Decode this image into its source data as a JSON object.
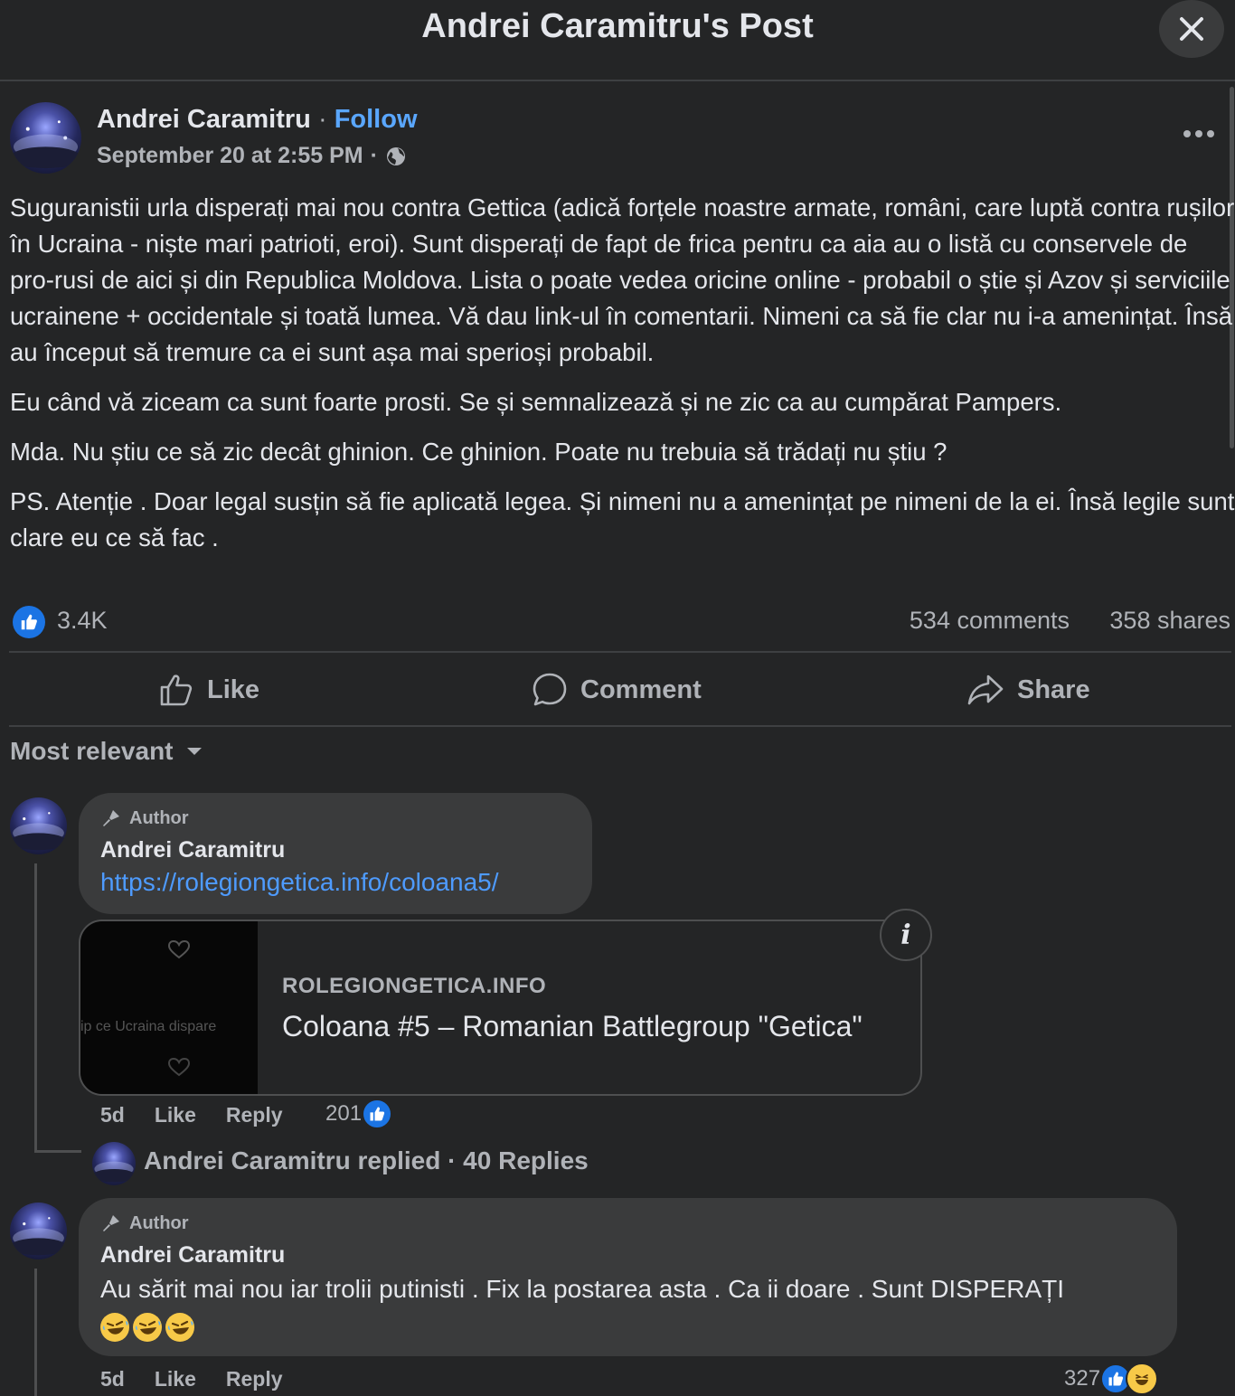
{
  "header": {
    "title": "Andrei Caramitru's Post"
  },
  "post": {
    "author": "Andrei Caramitru",
    "separator": "·",
    "follow_label": "Follow",
    "timestamp": "September 20 at 2:55 PM",
    "meta_separator": "·",
    "privacy_icon": "globe-icon",
    "paragraphs": [
      "Suguranistii urla disperați mai nou contra Gettica (adică forțele noastre armate, români, care luptă contra rușilor în Ucraina - niște mari patrioti, eroi). Sunt disperați de fapt de frica pentru ca aia au o listă cu conservele de pro-rusi de aici și din Republica Moldova. Lista o poate vedea oricine online - probabil o știe și Azov și serviciile ucrainene + occidentale și toată lumea. Vă dau link-ul în comentarii. Nimeni ca să fie clar nu i-a amenințat. Însă au început să tremure ca ei sunt așa mai sperioși probabil.",
      "Eu când vă ziceam ca sunt foarte prosti. Se și semnalizează și ne zic ca au cumpărat Pampers.",
      "Mda. Nu știu ce să zic decât ghinion. Ce ghinion. Poate nu trebuia să trădați nu știu ?",
      "PS. Atenție . Doar legal susțin să fie aplicată legea. Și nimeni nu a amenințat pe nimeni de la ei. Însă legile sunt clare eu ce să fac ."
    ],
    "reactions_count": "3.4K",
    "comments_count": "534 comments",
    "shares_count": "358 shares"
  },
  "actions": {
    "like": "Like",
    "comment": "Comment",
    "share": "Share"
  },
  "sort_label": "Most relevant",
  "comments": [
    {
      "author_tag": "Author",
      "name": "Andrei Caramitru",
      "link": "https://rolegiongetica.info/coloana5/",
      "link_preview": {
        "thumb_text": "ip ce Ucraina dispare",
        "domain": "ROLEGIONGETICA.INFO",
        "title": "Coloana #5 – Romanian Battlegroup \"Getica\""
      },
      "time": "5d",
      "like_label": "Like",
      "reply_label": "Reply",
      "reaction_count": "201",
      "replies_text": "Andrei Caramitru replied · 40 Replies"
    },
    {
      "author_tag": "Author",
      "name": "Andrei Caramitru",
      "text": "Au sărit mai nou iar trolii putinisti . Fix la postarea asta . Ca ii doare . Sunt DISPERAȚI",
      "emojis": [
        "rolling-laughing-emoji",
        "rolling-laughing-emoji",
        "rolling-laughing-emoji"
      ],
      "time": "5d",
      "like_label": "Like",
      "reply_label": "Reply",
      "reaction_count": "327"
    }
  ],
  "colors": {
    "background": "#242526",
    "bubble": "#3a3b3c",
    "link": "#4e9bff",
    "accent": "#1b74e4",
    "muted": "#b0b3b8"
  }
}
